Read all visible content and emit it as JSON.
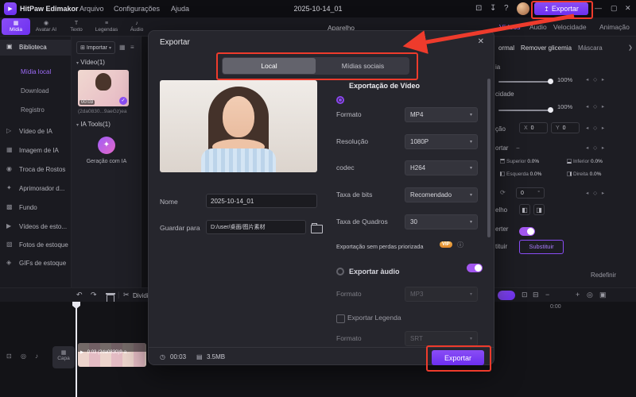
{
  "colors": {
    "accent": "#7c3af0",
    "accent_light": "#9f62f8",
    "annotation_red": "#ee3b2c",
    "vip_gold": "#e89a3c",
    "panel_bg": "#1d1d23",
    "dialog_bg": "#26262d"
  },
  "icons": {
    "logo": "▶",
    "export_arrow": "↥",
    "panel": "⊡",
    "download": "↧",
    "help": "?",
    "minimize": "—",
    "maximize": "▢",
    "close": "✕",
    "caret_down": "▾",
    "chevron_right": "❯",
    "import": "⊞",
    "grid_view": "▦",
    "list_view": "≡",
    "check": "✓",
    "sparkle": "✦",
    "undo": "↶",
    "redo": "↷",
    "scissors": "✂",
    "overlay": "⊡",
    "compact": "⊟",
    "minus": "−",
    "plus": "+",
    "locate": "◎",
    "fit": "▣",
    "play": "▶",
    "clock": "◷",
    "file": "▤",
    "info": "ⓘ",
    "flip_h": "◧",
    "flip_v": "◨",
    "rotate": "⟳",
    "keyframe": "◂ ◇ ▸",
    "track_sticker": "⊡",
    "track_eye": "◎",
    "track_audio": "♪",
    "degree": "°"
  },
  "titlebar": {
    "app_name": "HitPaw Edimakor",
    "menus": [
      "Arquivo",
      "Configurações",
      "Ajuda"
    ],
    "project_title": "2025-10-14_01",
    "export_label": "Exportar"
  },
  "ribbon": {
    "tabs": [
      {
        "icon": "▦",
        "label": "Mídia"
      },
      {
        "icon": "◉",
        "label": "Avatar AI"
      },
      {
        "icon": "T",
        "label": "Texto"
      },
      {
        "icon": "≡",
        "label": "Legendas"
      },
      {
        "icon": "♪",
        "label": "Áudio"
      }
    ]
  },
  "preview": {
    "device_label": "Aparelho"
  },
  "sidebar": {
    "items": [
      {
        "icon": "▣",
        "label": "Biblioteca"
      },
      {
        "icon": "",
        "label": "Mídia local"
      },
      {
        "icon": "",
        "label": "Download"
      },
      {
        "icon": "",
        "label": "Registro"
      },
      {
        "icon": "▷",
        "label": "Vídeo de IA"
      },
      {
        "icon": "▦",
        "label": "Imagem de IA"
      },
      {
        "icon": "◉",
        "label": "Troca de Rostos"
      },
      {
        "icon": "✦",
        "label": "Aprimorador d..."
      },
      {
        "icon": "▩",
        "label": "Fundo"
      },
      {
        "icon": "▶",
        "label": "Vídeos de esto..."
      },
      {
        "icon": "▧",
        "label": "Fotos de estoque"
      },
      {
        "icon": "◈",
        "label": "GIFs de estoque"
      }
    ]
  },
  "media_panel": {
    "import_label": "Importar",
    "video_group": "Vídeo(1)",
    "clip_duration": "00:03",
    "clip_caption": "(2da0830...9aeGz)ea",
    "ai_group": "IA Tools(1)",
    "ai_card_label": "Geração com IA"
  },
  "right_panel": {
    "tabs": [
      {
        "label": "Vídeos"
      },
      {
        "label": "Áudio"
      },
      {
        "label": "Velocidade"
      },
      {
        "label": "Animação"
      }
    ],
    "sub_tabs": [
      {
        "label": "ormal"
      },
      {
        "label": "Remover glicemia"
      },
      {
        "label": "Máscara"
      }
    ],
    "opacity_label": "ia",
    "opacity_value": "100%",
    "scale_label": "cidade",
    "scale_value": "100%",
    "position_label": "ção",
    "pos_x_label": "X",
    "pos_x_value": "0",
    "pos_y_label": "Y",
    "pos_y_value": "0",
    "crop_label": "ortar",
    "crop": {
      "top_label": "Superior",
      "top_value": "0.0%",
      "bottom_label": "Inferior",
      "bottom_value": "0.0%",
      "left_label": "Esquerda",
      "left_value": "0.0%",
      "right_label": "Direita",
      "right_value": "0.0%"
    },
    "rotation_value": "0",
    "mirror_label": "elho",
    "invert_label": "erter",
    "replace_label": "tituir",
    "replace_button": "Substituir",
    "reset_label": "Redefinir"
  },
  "toolbar": {
    "split_label": "Dividir",
    "timecode": "0:00"
  },
  "timeline": {
    "cover_label": "Capa",
    "clip_label": "0:03 (2da0830)9-a..."
  },
  "dialog": {
    "title": "Exportar",
    "tabs": [
      {
        "label": "Local"
      },
      {
        "label": "Mídias sociais"
      }
    ],
    "name_label": "Nome",
    "name_value": "2025-10-14_01",
    "path_label": "Guardar para",
    "path_value": "D:/user/桌面/图片素材",
    "video": {
      "section_title": "Exportação de Vídeo",
      "rows": [
        {
          "label": "Formato",
          "value": "MP4"
        },
        {
          "label": "Resolução",
          "value": "1080P"
        },
        {
          "label": "codec",
          "value": "H264"
        },
        {
          "label": "Taxa de bits",
          "value": "Recomendado"
        },
        {
          "label": "Taxa de Quadros",
          "value": "30"
        }
      ],
      "lossless_label": "Exportação sem perdas priorizada",
      "vip_badge": "VIP"
    },
    "audio": {
      "section_title": "Exportar àudio",
      "format_label": "Formato",
      "format_value": "MP3"
    },
    "subtitle": {
      "section_title": "Exportar Legenda",
      "format_label": "Formato",
      "format_value": "SRT"
    },
    "footer": {
      "duration": "00:03",
      "size": "3.5MB",
      "export_label": "Exportar"
    }
  }
}
